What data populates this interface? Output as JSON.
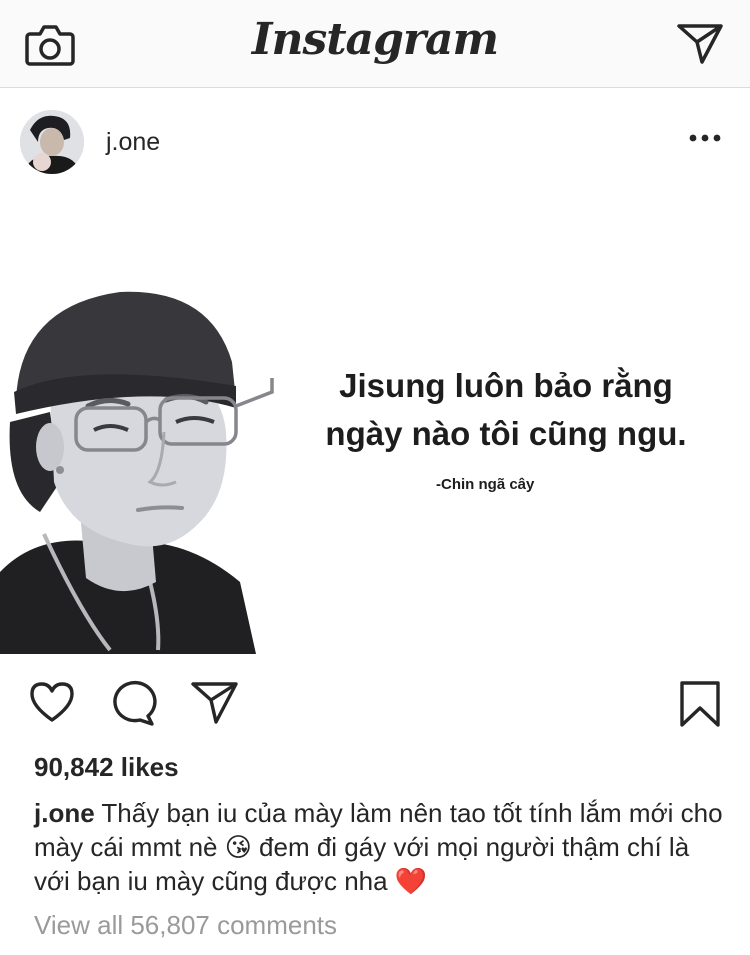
{
  "app": {
    "logo_text": "Instagram"
  },
  "header_icons": [
    "camera-icon",
    "direct-message-icon"
  ],
  "post": {
    "username": "j.one",
    "image_text": {
      "quote_line_1": "Jisung luôn bảo rằng",
      "quote_line_2": "ngày nào tôi cũng ngu.",
      "signature": "-Chin ngã cây"
    },
    "likes": "90,842 likes",
    "caption_user": "j.one",
    "caption_text": " Thấy bạn iu của mày làm nên tao tốt tính lắm mới cho mày cái mmt nè 😘 đem đi gáy với mọi người thậm chí là với bạn iu mày cũng được nha ❤️",
    "view_comments": "View all 56,807 comments"
  },
  "actions": [
    "like-icon",
    "comment-icon",
    "share-icon",
    "save-icon"
  ]
}
